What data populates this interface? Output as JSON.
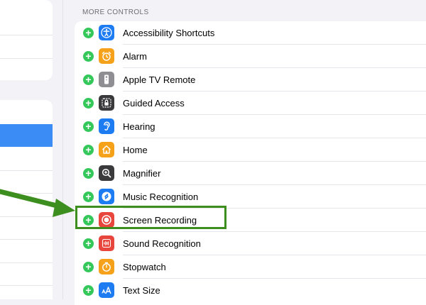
{
  "section": {
    "header": "MORE CONTROLS"
  },
  "controls": [
    {
      "label": "Accessibility Shortcuts",
      "icon": "accessibility-icon",
      "color": "#1e7cf2"
    },
    {
      "label": "Alarm",
      "icon": "alarm-clock-icon",
      "color": "#f5a21a"
    },
    {
      "label": "Apple TV Remote",
      "icon": "remote-icon",
      "color": "#8e8e93"
    },
    {
      "label": "Guided Access",
      "icon": "lock-icon",
      "color": "#3a3a3c"
    },
    {
      "label": "Hearing",
      "icon": "ear-icon",
      "color": "#1e7cf2"
    },
    {
      "label": "Home",
      "icon": "home-icon",
      "color": "#f5a21a"
    },
    {
      "label": "Magnifier",
      "icon": "magnifier-icon",
      "color": "#3a3a3c"
    },
    {
      "label": "Music Recognition",
      "icon": "shazam-icon",
      "color": "#1e7cf2"
    },
    {
      "label": "Screen Recording",
      "icon": "record-icon",
      "color": "#e8453c"
    },
    {
      "label": "Sound Recognition",
      "icon": "waveform-icon",
      "color": "#e8453c"
    },
    {
      "label": "Stopwatch",
      "icon": "stopwatch-icon",
      "color": "#f5a21a"
    },
    {
      "label": "Text Size",
      "icon": "text-size-icon",
      "color": "#1e7cf2"
    }
  ],
  "highlight": {
    "color": "#3c8f1e",
    "target": "Screen Recording"
  }
}
